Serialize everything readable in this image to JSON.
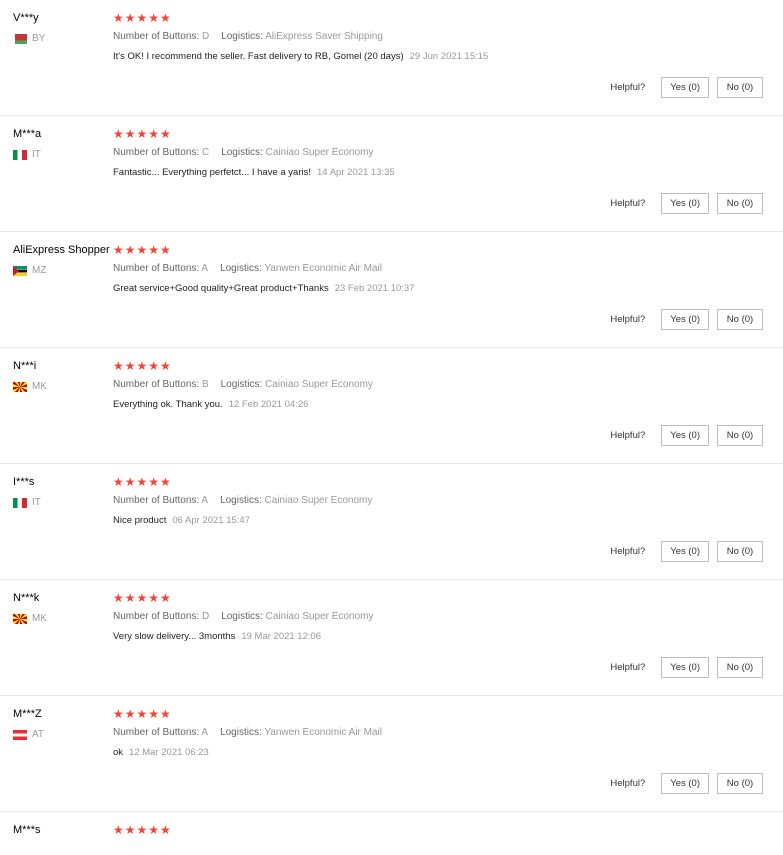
{
  "reviews": [
    {
      "name": "V***y",
      "country": "BY",
      "flag": "by",
      "stars": "★★★★★",
      "buttons_label": "Number of Buttons:",
      "buttons_value": "D",
      "logistics_label": "Logistics:",
      "logistics_value": "AliExpress Saver Shipping",
      "text": "It's OK! I recommend the seller. Fast delivery to RB, Gomel (20 days)",
      "date": "29 Jun 2021 15:15",
      "helpful": "Helpful?",
      "yes": "Yes (0)",
      "no": "No (0)"
    },
    {
      "name": "M***a",
      "country": "IT",
      "flag": "it",
      "stars": "★★★★★",
      "buttons_label": "Number of Buttons:",
      "buttons_value": "C",
      "logistics_label": "Logistics:",
      "logistics_value": "Cainiao Super Economy",
      "text": "Fantastic... Everything perfetct... I have a yaris!",
      "date": "14 Apr 2021 13:35",
      "helpful": "Helpful?",
      "yes": "Yes (0)",
      "no": "No (0)"
    },
    {
      "name": "AliExpress Shopper",
      "country": "MZ",
      "flag": "mz",
      "stars": "★★★★★",
      "buttons_label": "Number of Buttons:",
      "buttons_value": "A",
      "logistics_label": "Logistics:",
      "logistics_value": "Yanwen Economic Air Mail",
      "text": "Great service+Good quality+Great product+Thanks",
      "date": "23 Feb 2021 10:37",
      "helpful": "Helpful?",
      "yes": "Yes (0)",
      "no": "No (0)"
    },
    {
      "name": "N***i",
      "country": "MK",
      "flag": "mk",
      "stars": "★★★★★",
      "buttons_label": "Number of Buttons:",
      "buttons_value": "B",
      "logistics_label": "Logistics:",
      "logistics_value": "Cainiao Super Economy",
      "text": "Everything ok. Thank you.",
      "date": "12 Feb 2021 04:26",
      "helpful": "Helpful?",
      "yes": "Yes (0)",
      "no": "No (0)"
    },
    {
      "name": "I***s",
      "country": "IT",
      "flag": "it",
      "stars": "★★★★★",
      "buttons_label": "Number of Buttons:",
      "buttons_value": "A",
      "logistics_label": "Logistics:",
      "logistics_value": "Cainiao Super Economy",
      "text": "Nice product",
      "date": "06 Apr 2021 15:47",
      "helpful": "Helpful?",
      "yes": "Yes (0)",
      "no": "No (0)"
    },
    {
      "name": "N***k",
      "country": "MK",
      "flag": "mk",
      "stars": "★★★★★",
      "buttons_label": "Number of Buttons:",
      "buttons_value": "D",
      "logistics_label": "Logistics:",
      "logistics_value": "Cainiao Super Economy",
      "text": "Very slow delivery... 3months",
      "date": "19 Mar 2021 12:06",
      "helpful": "Helpful?",
      "yes": "Yes (0)",
      "no": "No (0)"
    },
    {
      "name": "M***Z",
      "country": "AT",
      "flag": "at",
      "stars": "★★★★★",
      "buttons_label": "Number of Buttons:",
      "buttons_value": "A",
      "logistics_label": "Logistics:",
      "logistics_value": "Yanwen Economic Air Mail",
      "text": "ok",
      "date": "12 Mar 2021 06:23",
      "helpful": "Helpful?",
      "yes": "Yes (0)",
      "no": "No (0)"
    },
    {
      "name": "M***s",
      "stars": "★★★★★"
    }
  ],
  "colors": {
    "star": "#f44336",
    "border": "#e6e6e6",
    "muted": "#999999"
  }
}
